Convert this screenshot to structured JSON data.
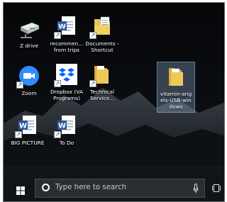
{
  "desktop": {
    "icons": [
      {
        "label": "Z drive",
        "type": "drive"
      },
      {
        "label": "recommen... from trips",
        "type": "word"
      },
      {
        "label": "Documents - Shortcut",
        "type": "folder-docs"
      },
      {
        "label": "Zoom",
        "type": "zoom"
      },
      {
        "label": "Dropbox (VA Programs)",
        "type": "dropbox"
      },
      {
        "label": "Technical Service...",
        "type": "folder"
      },
      {
        "label": "vitamin-angels-USB-windows",
        "type": "folder-selected"
      },
      {
        "label": "BIG PICTURE",
        "type": "word"
      },
      {
        "label": "To Do",
        "type": "word"
      }
    ]
  },
  "taskbar": {
    "search_placeholder": "Type here to search",
    "start_icon": "windows-logo-icon",
    "mic_icon": "microphone-icon",
    "taskview_icon": "task-view-icon"
  },
  "colors": {
    "word_blue": "#2b579a",
    "zoom_blue": "#2d8cff",
    "dropbox_blue": "#0061fe",
    "folder_yellow": "#e8c25a",
    "taskbar": "#101317"
  }
}
